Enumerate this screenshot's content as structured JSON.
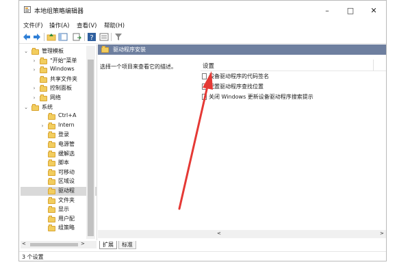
{
  "window": {
    "title": "本地组策略编辑器",
    "min": "–",
    "max": "□",
    "close": "✕"
  },
  "menu": [
    "文件(F)",
    "操作(A)",
    "查看(V)",
    "帮助(H)"
  ],
  "tree": {
    "items": [
      {
        "label": "管理模板",
        "expanded": true
      },
      {
        "label": "\"开始\"菜单"
      },
      {
        "label": "Windows"
      },
      {
        "label": "共享文件夹"
      },
      {
        "label": "控制面板"
      },
      {
        "label": "网络"
      },
      {
        "label": "系统",
        "expanded": true
      },
      {
        "label": "Ctrl+A"
      },
      {
        "label": "Intern"
      },
      {
        "label": "登录"
      },
      {
        "label": "电源管"
      },
      {
        "label": "缓解选"
      },
      {
        "label": "脚本"
      },
      {
        "label": "可移动"
      },
      {
        "label": "区域设"
      },
      {
        "label": "驱动程",
        "selected": true
      },
      {
        "label": "文件夹"
      },
      {
        "label": "显示"
      },
      {
        "label": "用户配"
      },
      {
        "label": "组策略"
      }
    ]
  },
  "right": {
    "header": "驱动程序安装",
    "description": "选择一个项目来查看它的描述。",
    "settings_header": "设置",
    "settings": [
      "设备驱动程序的代码签名",
      "配置驱动程序查找位置",
      "关闭 Windows 更新设备驱动程序搜索提示"
    ]
  },
  "tabs": {
    "expand": "扩展",
    "standard": "标准"
  },
  "status": "3 个设置",
  "colors": {
    "header_bg": "#6e7f9f",
    "arrow": "#e53935",
    "folder": "#f2cd5e"
  }
}
